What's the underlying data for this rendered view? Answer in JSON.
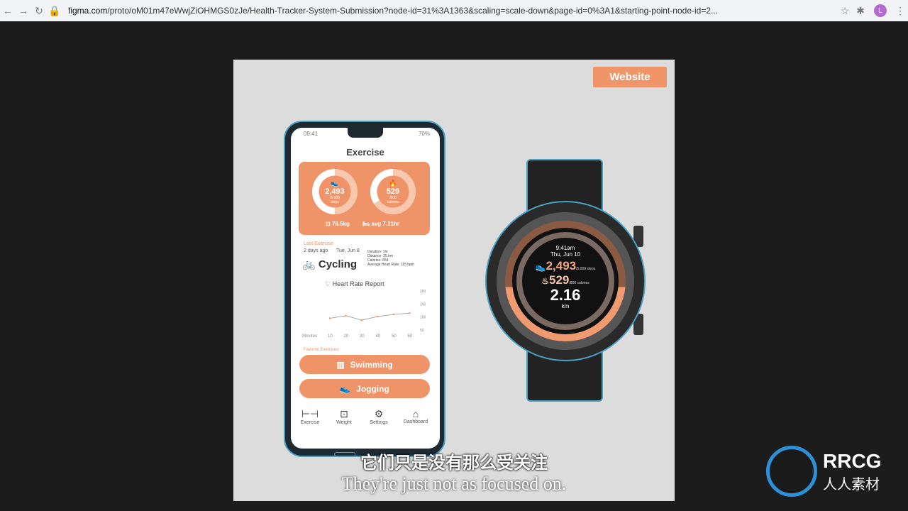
{
  "browser": {
    "url_domain": "figma.com",
    "url_path": "/proto/oM01m47eWwjZiOHMGS0zJe/Health-Tracker-System-Submission?node-id=31%3A1363&scaling=scale-down&page-id=0%3A1&starting-point-node-id=2...",
    "avatar": "L"
  },
  "website_button": "Website",
  "phone": {
    "time": "09:41",
    "battery": "70%",
    "title": "Exercise",
    "steps": {
      "value": "2,493",
      "goal": "/5,000",
      "unit": "steps",
      "progress": 0.5
    },
    "calories": {
      "value": "529",
      "goal": "/800",
      "unit": "calories",
      "progress": 0.66
    },
    "weight": "78.5kg",
    "sleep": "avg 7.21hr",
    "last_exercise": {
      "label": "Last Exercise",
      "ago": "2 days ago",
      "date": "Tue, Jun 8",
      "name": "Cycling",
      "stats": [
        "Duration: 1hr",
        "Distance: 25 km",
        "Calories: 654",
        "Average Heart Rate: 115 bpm"
      ]
    },
    "heart_rate": {
      "title": "Heart Rate Report",
      "xlabel": "Minutes",
      "x": [
        10,
        20,
        30,
        40,
        50,
        60
      ],
      "y": [
        95,
        105,
        88,
        102,
        110,
        115
      ],
      "yticks": [
        200,
        150,
        100,
        50
      ],
      "ylim": [
        50,
        200
      ],
      "color": "#ef9468"
    },
    "favorites_label": "Favorite Exercises",
    "favorites": [
      "Swimming",
      "Jogging"
    ],
    "nav": [
      "Exercise",
      "Weight",
      "Settings",
      "Dashboard"
    ],
    "accent": "#ef9468"
  },
  "watch": {
    "time": "9:41am",
    "date": "Thu, Jun 10",
    "steps": "2,493",
    "steps_goal": "/5,000 steps",
    "calories": "529",
    "calories_goal": "/800 calories",
    "distance": "2.16",
    "distance_unit": "km"
  },
  "subtitles": {
    "zh": "它们只是没有那么受关注",
    "en": "They're just not as focused on."
  },
  "logo": {
    "text1": "RRCG",
    "text2": "人人素材"
  }
}
